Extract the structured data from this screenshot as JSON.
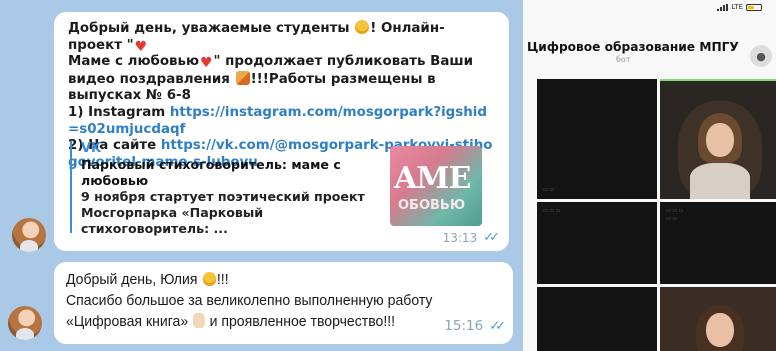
{
  "chat": {
    "messages": [
      {
        "text_a": "Добрый день, уважаемые студенты",
        "text_b": "! Онлайн-проект \"",
        "text_c": "Маме с любовью",
        "text_d": "\" продолжает публиковать Ваши видео поздравления",
        "text_e": "!!!Работы размещены в выпусках № 6-8",
        "line1_label": "1) Instagram",
        "line1_link": "https://instagram.com/mosgorpark?igshid=s02umjucdaqf",
        "line2_label": "2) На сайте",
        "line2_link": "https://vk.com/@mosgorpark-parkovyi-stihogovoritel-mame-s-lubovu",
        "preview": {
          "source": "VK",
          "title": "Парковый стихоговоритель: маме с любовью",
          "description": "9 ноября стартует поэтический проект Мосгорпарка «Парковый стихоговоритель: ...",
          "thumb_text_1": "AME",
          "thumb_text_2": "ОБОВЬЮ"
        },
        "time": "13:13"
      },
      {
        "line1_a": "Добрый день, Юлия",
        "line1_b": "!!!",
        "line2": "Спасибо большое за великолепно выполненную работу",
        "line3_a": "«Цифровая книга»",
        "line3_b": "и проявленное творчество!!!",
        "time": "15:16"
      }
    ]
  },
  "phone": {
    "status_network": "LTE",
    "call_title": "Цифровое образование МПГУ",
    "call_subtitle": "бот"
  },
  "icons": {
    "emoji_smile": "smile-emoji-icon",
    "emoji_heart": "heart-emoji-icon",
    "emoji_party": "party-emoji-icon",
    "emoji_thumb": "thumbs-up-emoji-icon",
    "read_checks": "double-check-icon"
  },
  "colors": {
    "chat_background": "#a9c9e6",
    "link": "#2f7fc4",
    "accent": "#3b8ed6",
    "active_speaker": "#86d67a"
  }
}
